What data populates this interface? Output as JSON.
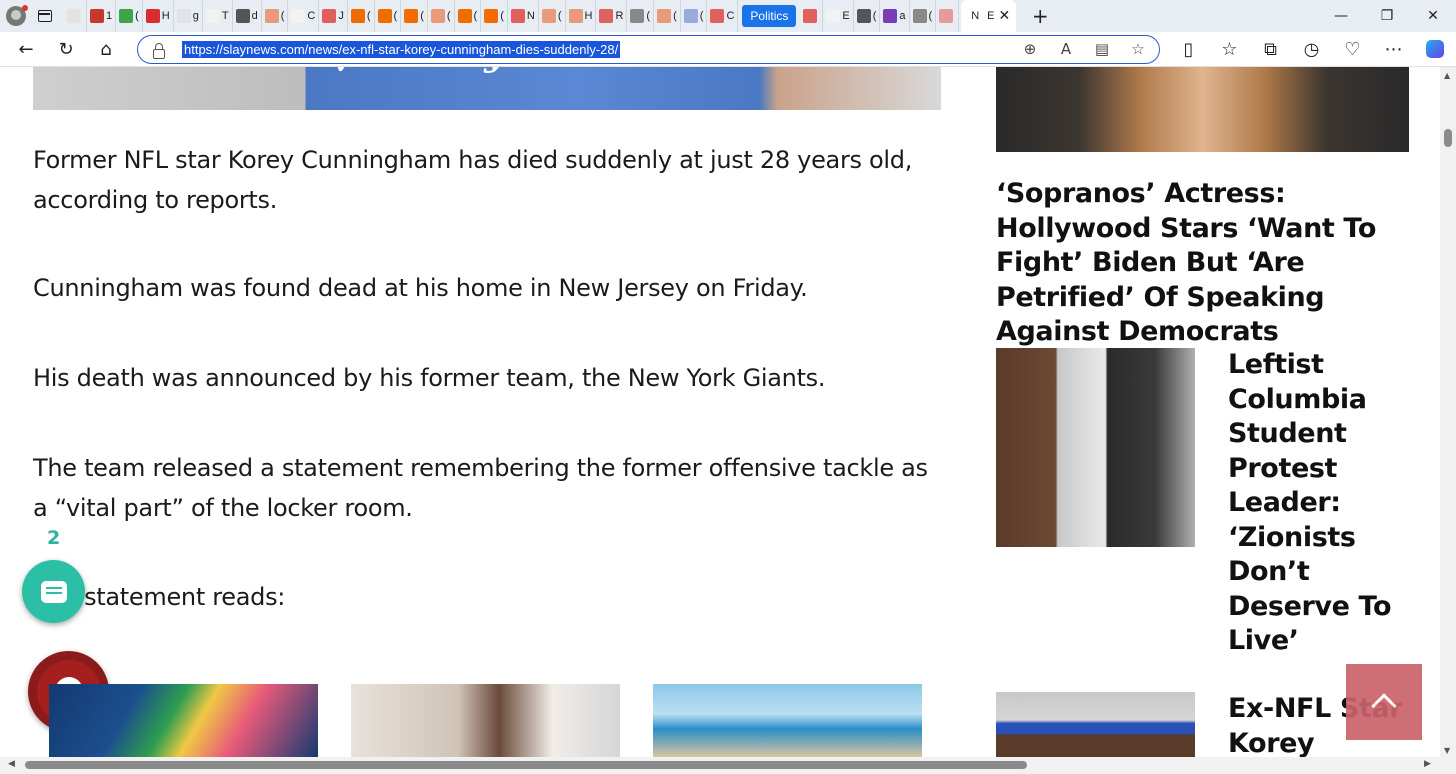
{
  "browser": {
    "tabs_mini": [
      {
        "letter": "",
        "color": "#e3e3e3"
      },
      {
        "letter": "1",
        "color": "#c6382e"
      },
      {
        "letter": "(",
        "color": "#3aa648"
      },
      {
        "letter": "H",
        "color": "#d92d2d"
      },
      {
        "letter": "g",
        "color": "#dfe3e8"
      },
      {
        "letter": "T",
        "color": "#f2f2f2"
      },
      {
        "letter": "d",
        "color": "#555555"
      },
      {
        "letter": "(",
        "color": "#e89a7a"
      },
      {
        "letter": "C",
        "color": "#f2f2f2"
      },
      {
        "letter": "J",
        "color": "#e06060"
      },
      {
        "letter": "(",
        "color": "#ef6c00"
      },
      {
        "letter": "(",
        "color": "#ef6c00"
      },
      {
        "letter": "(",
        "color": "#ef6c00"
      },
      {
        "letter": "(",
        "color": "#e89a7a"
      },
      {
        "letter": "(",
        "color": "#ef6c00"
      },
      {
        "letter": "(",
        "color": "#ef6c00"
      },
      {
        "letter": "N",
        "color": "#e06060"
      },
      {
        "letter": "(",
        "color": "#e89a7a"
      },
      {
        "letter": "H",
        "color": "#e89a7a"
      },
      {
        "letter": "R",
        "color": "#e06060"
      },
      {
        "letter": "(",
        "color": "#888888"
      },
      {
        "letter": "(",
        "color": "#e89a7a"
      },
      {
        "letter": "(",
        "color": "#9ad"
      },
      {
        "letter": "C",
        "color": "#e06060"
      }
    ],
    "politics_tab": "Politics",
    "tabs_after": [
      {
        "letter": "",
        "color": "#e06060"
      },
      {
        "letter": "E",
        "color": "#f2f2f2"
      },
      {
        "letter": "(",
        "color": "#555555"
      },
      {
        "letter": "a",
        "color": "#7a3db8"
      },
      {
        "letter": "(",
        "color": "#888888"
      },
      {
        "letter": "",
        "color": "#e89a9a"
      }
    ],
    "active_tab_letter": "N",
    "active_tab_short": "E",
    "close_glyph": "✕",
    "new_tab_glyph": "+",
    "window": {
      "minimize": "—",
      "restore": "❐",
      "close": "✕"
    },
    "url": "https://slaynews.com/news/ex-nfl-star-korey-cunningham-dies-suddenly-28/",
    "nav": {
      "back": "←",
      "reload": "↻",
      "home": "⌂"
    },
    "omni_icons": [
      "⊕",
      "A",
      "▤",
      "☆"
    ],
    "right_icons": [
      "▯",
      "☆",
      "⧉",
      "◷",
      "♡",
      "⋯"
    ]
  },
  "article": {
    "paragraphs": [
      "Former NFL star Korey Cunningham has died suddenly at just 28 years old, according to reports.",
      "Cunningham was found dead at his home in New Jersey on Friday.",
      "His death was announced by his former team, the New York Giants.",
      "The team released a statement remembering the former offensive tackle as a “vital part” of the locker room.",
      "The statement reads:"
    ],
    "hero_logo_text": "ny",
    "hero_swoosh": "✓"
  },
  "comments": {
    "count": "2"
  },
  "sidebar": {
    "headline_1": "‘Sopranos’ Actress: Hollywood Stars ‘Want To Fight’ Biden But ‘Are Petrified’ Of Speaking Against Democrats",
    "item_columbia": "Leftist Columbia Student Protest Leader: ‘Zionists Don’t Deserve To Live’",
    "item_ex_nfl": "Ex-NFL Star Korey"
  },
  "scroll": {
    "up": "▲",
    "down": "▼",
    "left": "◀",
    "right": "▶"
  }
}
